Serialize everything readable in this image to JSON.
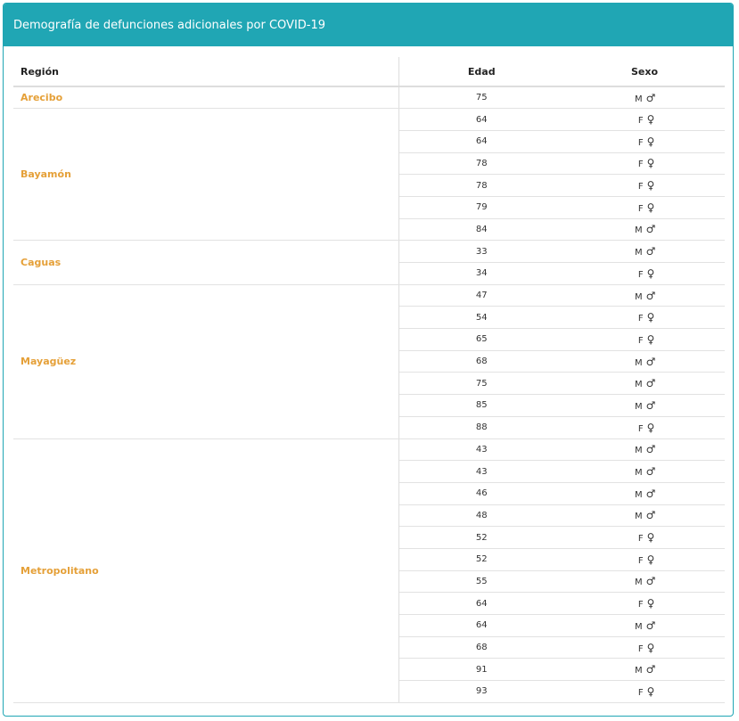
{
  "panel": {
    "title": "Demografía de defunciones adicionales por COVID-19"
  },
  "table": {
    "headers": {
      "region": "Región",
      "edad": "Edad",
      "sexo": "Sexo"
    },
    "groups": [
      {
        "region": "Arecibo",
        "rows": [
          {
            "edad": "75",
            "sexo": "M"
          }
        ]
      },
      {
        "region": "Bayamón",
        "rows": [
          {
            "edad": "64",
            "sexo": "F"
          },
          {
            "edad": "64",
            "sexo": "F"
          },
          {
            "edad": "78",
            "sexo": "F"
          },
          {
            "edad": "78",
            "sexo": "F"
          },
          {
            "edad": "79",
            "sexo": "F"
          },
          {
            "edad": "84",
            "sexo": "M"
          }
        ]
      },
      {
        "region": "Caguas",
        "rows": [
          {
            "edad": "33",
            "sexo": "M"
          },
          {
            "edad": "34",
            "sexo": "F"
          }
        ]
      },
      {
        "region": "Mayagüez",
        "rows": [
          {
            "edad": "47",
            "sexo": "M"
          },
          {
            "edad": "54",
            "sexo": "F"
          },
          {
            "edad": "65",
            "sexo": "F"
          },
          {
            "edad": "68",
            "sexo": "M"
          },
          {
            "edad": "75",
            "sexo": "M"
          },
          {
            "edad": "85",
            "sexo": "M"
          },
          {
            "edad": "88",
            "sexo": "F"
          }
        ]
      },
      {
        "region": "Metropolitano",
        "rows": [
          {
            "edad": "43",
            "sexo": "M"
          },
          {
            "edad": "43",
            "sexo": "M"
          },
          {
            "edad": "46",
            "sexo": "M"
          },
          {
            "edad": "48",
            "sexo": "M"
          },
          {
            "edad": "52",
            "sexo": "F"
          },
          {
            "edad": "52",
            "sexo": "F"
          },
          {
            "edad": "55",
            "sexo": "M"
          },
          {
            "edad": "64",
            "sexo": "F"
          },
          {
            "edad": "64",
            "sexo": "M"
          },
          {
            "edad": "68",
            "sexo": "F"
          },
          {
            "edad": "91",
            "sexo": "M"
          },
          {
            "edad": "93",
            "sexo": "F"
          }
        ]
      }
    ]
  },
  "icons": {
    "M": "male-icon",
    "F": "female-icon"
  },
  "colors": {
    "header_bg": "#20a6b4",
    "region_text": "#e5a038"
  }
}
